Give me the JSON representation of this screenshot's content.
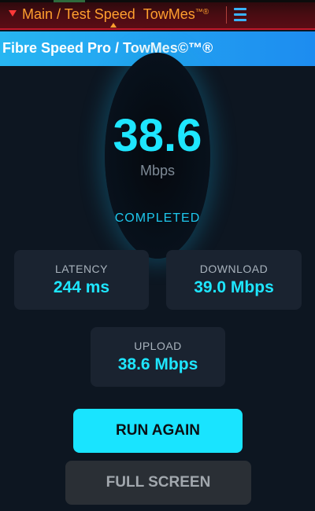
{
  "header": {
    "breadcrumb_path": "Main / Test Speed",
    "brand": "TowMes",
    "brand_mark": "™®",
    "menu_icon": "hamburger-menu-icon",
    "dropdown_icon": "triangle-down-icon"
  },
  "app": {
    "title": "Fibre Speed Pro / TowMes©™®"
  },
  "result": {
    "speed_value": "38.6",
    "speed_unit": "Mbps",
    "status": "COMPLETED"
  },
  "stats": {
    "latency": {
      "label": "LATENCY",
      "value": "244 ms"
    },
    "download": {
      "label": "DOWNLOAD",
      "value": "39.0 Mbps"
    },
    "upload": {
      "label": "UPLOAD",
      "value": "38.6 Mbps"
    }
  },
  "actions": {
    "run_again": "RUN AGAIN",
    "full_screen": "FULL SCREEN"
  },
  "colors": {
    "accent": "#19e4ff",
    "header_text": "#ff9f2e",
    "appbar": "#1d8cf0",
    "background": "#0d1621"
  }
}
